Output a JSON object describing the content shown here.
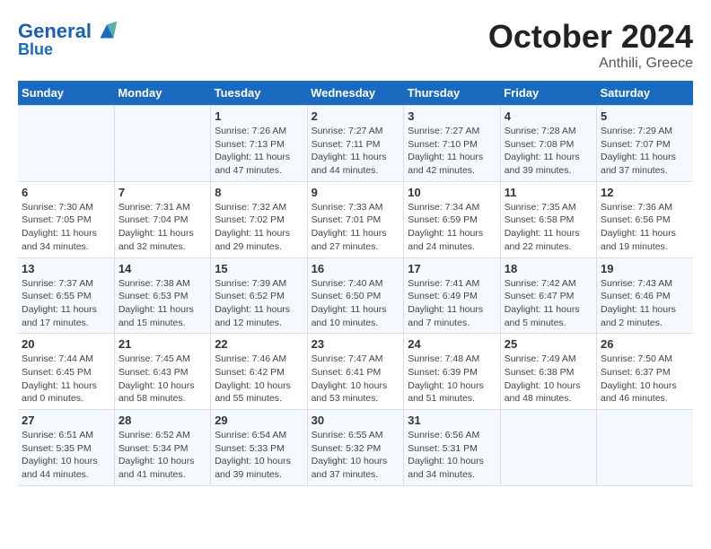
{
  "header": {
    "logo_line1": "General",
    "logo_line2": "Blue",
    "month_title": "October 2024",
    "location": "Anthili, Greece"
  },
  "days_of_week": [
    "Sunday",
    "Monday",
    "Tuesday",
    "Wednesday",
    "Thursday",
    "Friday",
    "Saturday"
  ],
  "weeks": [
    [
      {
        "day": "",
        "sunrise": "",
        "sunset": "",
        "daylight": ""
      },
      {
        "day": "",
        "sunrise": "",
        "sunset": "",
        "daylight": ""
      },
      {
        "day": "1",
        "sunrise": "Sunrise: 7:26 AM",
        "sunset": "Sunset: 7:13 PM",
        "daylight": "Daylight: 11 hours and 47 minutes."
      },
      {
        "day": "2",
        "sunrise": "Sunrise: 7:27 AM",
        "sunset": "Sunset: 7:11 PM",
        "daylight": "Daylight: 11 hours and 44 minutes."
      },
      {
        "day": "3",
        "sunrise": "Sunrise: 7:27 AM",
        "sunset": "Sunset: 7:10 PM",
        "daylight": "Daylight: 11 hours and 42 minutes."
      },
      {
        "day": "4",
        "sunrise": "Sunrise: 7:28 AM",
        "sunset": "Sunset: 7:08 PM",
        "daylight": "Daylight: 11 hours and 39 minutes."
      },
      {
        "day": "5",
        "sunrise": "Sunrise: 7:29 AM",
        "sunset": "Sunset: 7:07 PM",
        "daylight": "Daylight: 11 hours and 37 minutes."
      }
    ],
    [
      {
        "day": "6",
        "sunrise": "Sunrise: 7:30 AM",
        "sunset": "Sunset: 7:05 PM",
        "daylight": "Daylight: 11 hours and 34 minutes."
      },
      {
        "day": "7",
        "sunrise": "Sunrise: 7:31 AM",
        "sunset": "Sunset: 7:04 PM",
        "daylight": "Daylight: 11 hours and 32 minutes."
      },
      {
        "day": "8",
        "sunrise": "Sunrise: 7:32 AM",
        "sunset": "Sunset: 7:02 PM",
        "daylight": "Daylight: 11 hours and 29 minutes."
      },
      {
        "day": "9",
        "sunrise": "Sunrise: 7:33 AM",
        "sunset": "Sunset: 7:01 PM",
        "daylight": "Daylight: 11 hours and 27 minutes."
      },
      {
        "day": "10",
        "sunrise": "Sunrise: 7:34 AM",
        "sunset": "Sunset: 6:59 PM",
        "daylight": "Daylight: 11 hours and 24 minutes."
      },
      {
        "day": "11",
        "sunrise": "Sunrise: 7:35 AM",
        "sunset": "Sunset: 6:58 PM",
        "daylight": "Daylight: 11 hours and 22 minutes."
      },
      {
        "day": "12",
        "sunrise": "Sunrise: 7:36 AM",
        "sunset": "Sunset: 6:56 PM",
        "daylight": "Daylight: 11 hours and 19 minutes."
      }
    ],
    [
      {
        "day": "13",
        "sunrise": "Sunrise: 7:37 AM",
        "sunset": "Sunset: 6:55 PM",
        "daylight": "Daylight: 11 hours and 17 minutes."
      },
      {
        "day": "14",
        "sunrise": "Sunrise: 7:38 AM",
        "sunset": "Sunset: 6:53 PM",
        "daylight": "Daylight: 11 hours and 15 minutes."
      },
      {
        "day": "15",
        "sunrise": "Sunrise: 7:39 AM",
        "sunset": "Sunset: 6:52 PM",
        "daylight": "Daylight: 11 hours and 12 minutes."
      },
      {
        "day": "16",
        "sunrise": "Sunrise: 7:40 AM",
        "sunset": "Sunset: 6:50 PM",
        "daylight": "Daylight: 11 hours and 10 minutes."
      },
      {
        "day": "17",
        "sunrise": "Sunrise: 7:41 AM",
        "sunset": "Sunset: 6:49 PM",
        "daylight": "Daylight: 11 hours and 7 minutes."
      },
      {
        "day": "18",
        "sunrise": "Sunrise: 7:42 AM",
        "sunset": "Sunset: 6:47 PM",
        "daylight": "Daylight: 11 hours and 5 minutes."
      },
      {
        "day": "19",
        "sunrise": "Sunrise: 7:43 AM",
        "sunset": "Sunset: 6:46 PM",
        "daylight": "Daylight: 11 hours and 2 minutes."
      }
    ],
    [
      {
        "day": "20",
        "sunrise": "Sunrise: 7:44 AM",
        "sunset": "Sunset: 6:45 PM",
        "daylight": "Daylight: 11 hours and 0 minutes."
      },
      {
        "day": "21",
        "sunrise": "Sunrise: 7:45 AM",
        "sunset": "Sunset: 6:43 PM",
        "daylight": "Daylight: 10 hours and 58 minutes."
      },
      {
        "day": "22",
        "sunrise": "Sunrise: 7:46 AM",
        "sunset": "Sunset: 6:42 PM",
        "daylight": "Daylight: 10 hours and 55 minutes."
      },
      {
        "day": "23",
        "sunrise": "Sunrise: 7:47 AM",
        "sunset": "Sunset: 6:41 PM",
        "daylight": "Daylight: 10 hours and 53 minutes."
      },
      {
        "day": "24",
        "sunrise": "Sunrise: 7:48 AM",
        "sunset": "Sunset: 6:39 PM",
        "daylight": "Daylight: 10 hours and 51 minutes."
      },
      {
        "day": "25",
        "sunrise": "Sunrise: 7:49 AM",
        "sunset": "Sunset: 6:38 PM",
        "daylight": "Daylight: 10 hours and 48 minutes."
      },
      {
        "day": "26",
        "sunrise": "Sunrise: 7:50 AM",
        "sunset": "Sunset: 6:37 PM",
        "daylight": "Daylight: 10 hours and 46 minutes."
      }
    ],
    [
      {
        "day": "27",
        "sunrise": "Sunrise: 6:51 AM",
        "sunset": "Sunset: 5:35 PM",
        "daylight": "Daylight: 10 hours and 44 minutes."
      },
      {
        "day": "28",
        "sunrise": "Sunrise: 6:52 AM",
        "sunset": "Sunset: 5:34 PM",
        "daylight": "Daylight: 10 hours and 41 minutes."
      },
      {
        "day": "29",
        "sunrise": "Sunrise: 6:54 AM",
        "sunset": "Sunset: 5:33 PM",
        "daylight": "Daylight: 10 hours and 39 minutes."
      },
      {
        "day": "30",
        "sunrise": "Sunrise: 6:55 AM",
        "sunset": "Sunset: 5:32 PM",
        "daylight": "Daylight: 10 hours and 37 minutes."
      },
      {
        "day": "31",
        "sunrise": "Sunrise: 6:56 AM",
        "sunset": "Sunset: 5:31 PM",
        "daylight": "Daylight: 10 hours and 34 minutes."
      },
      {
        "day": "",
        "sunrise": "",
        "sunset": "",
        "daylight": ""
      },
      {
        "day": "",
        "sunrise": "",
        "sunset": "",
        "daylight": ""
      }
    ]
  ]
}
